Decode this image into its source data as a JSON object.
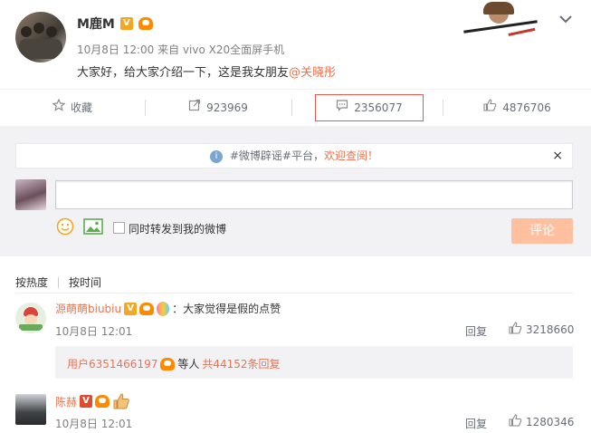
{
  "post": {
    "username": "M鹿M",
    "vbadge": "V",
    "meta": "10月8日 12:00 来自 vivo X20全面屏手机",
    "text": "大家好，给大家介绍一下，这是我女朋友",
    "mention": "@关晓彤",
    "expand_icon": "chevron-down-icon"
  },
  "actions": {
    "favorite_label": "收藏",
    "repost_count": "923969",
    "comment_count": "2356077",
    "like_count": "4876706",
    "active_color": "#e05a4e"
  },
  "notice": {
    "text": "#微博辟谣#平台，",
    "link": "欢迎查阅！",
    "close": "×"
  },
  "composer": {
    "placeholder": "",
    "repost_label": "同时转发到我的微博",
    "submit_label": "评论"
  },
  "sort": {
    "hot": "按热度",
    "time": "按时间"
  },
  "comments": [
    {
      "name": "源萌萌biubiu",
      "text": "：大家觉得是假的点赞",
      "time": "10月8日 12:01",
      "reply": "回复",
      "likes": "3218660",
      "sub_user": "用户6351466197",
      "sub_mid": "等人",
      "sub_total": "共44152条回复"
    },
    {
      "name": "陈赫",
      "text": "",
      "time": "10月8日 12:01",
      "reply": "回复",
      "likes": "1280346"
    }
  ]
}
